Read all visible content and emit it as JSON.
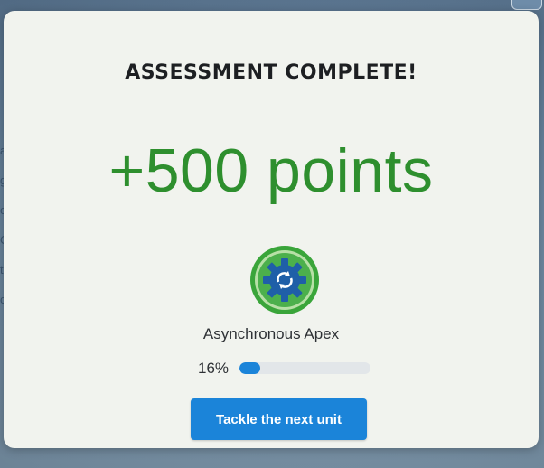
{
  "modal": {
    "title": "ASSESSMENT COMPLETE!",
    "points_text": "+500 points",
    "badge_icon": "gear-refresh-icon",
    "unit_name": "Asynchronous Apex",
    "progress": {
      "label": "16%",
      "value": 0.16
    },
    "cta_label": "Tackle the next unit"
  },
  "colors": {
    "points_green": "#2e8f2e",
    "accent_blue": "#1b84d9",
    "badge_green": "#3aa53a",
    "badge_blue": "#1f5fa8"
  }
}
